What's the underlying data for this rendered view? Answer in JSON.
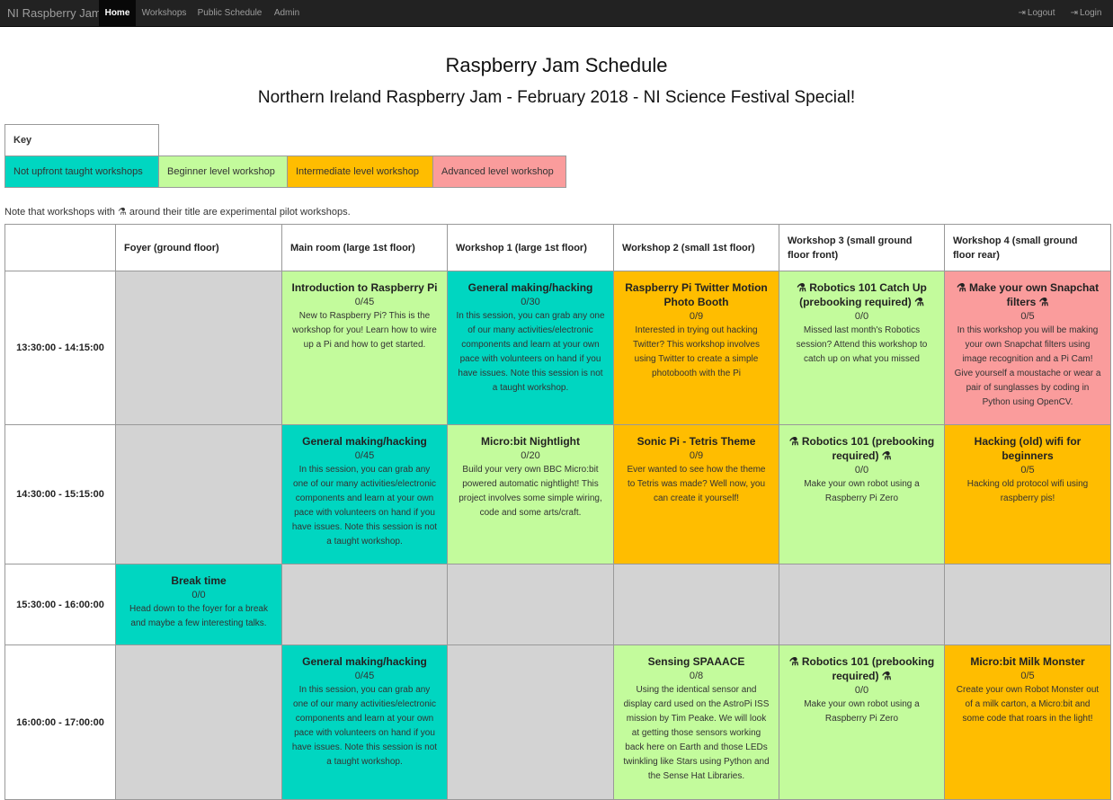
{
  "nav": {
    "brand": "NI Raspberry Jam",
    "items": [
      "Home",
      "Workshops",
      "Public Schedule",
      "Admin"
    ],
    "logout": "Logout",
    "login": "Login"
  },
  "page": {
    "title": "Raspberry Jam Schedule",
    "subtitle": "Northern Ireland Raspberry Jam - February 2018 - NI Science Festival Special!"
  },
  "key": {
    "title": "Key",
    "items": [
      "Not upfront taught workshops",
      "Beginner level workshop",
      "Intermediate level workshop",
      "Advanced level workshop"
    ],
    "colors": [
      "#00d6c1",
      "#c3fb9c",
      "#ffbd00",
      "#fa9c9c"
    ]
  },
  "note": {
    "before": "Note that workshops with",
    "after": "around their title are experimental pilot workshops."
  },
  "schedule": {
    "columns": [
      "Foyer (ground floor)",
      "Main room (large 1st floor)",
      "Workshop 1 (large 1st floor)",
      "Workshop 2 (small 1st floor)",
      "Workshop 3 (small ground floor front)",
      "Workshop 4 (small ground floor rear)"
    ],
    "rows": [
      {
        "time": "13:30:00 - 14:15:00",
        "cells": [
          null,
          {
            "title": "Introduction to Raspberry Pi",
            "count": "0/45",
            "desc": "New to Raspberry Pi? This is the workshop for you! Learn how to wire up a Pi and how to get started.",
            "level": "beginner",
            "pilot": false
          },
          {
            "title": "General making/hacking",
            "count": "0/30",
            "desc": "In this session, you can grab any one of our many activities/electronic components and learn at your own pace with volunteers on hand if you have issues. Note this session is not a taught workshop.",
            "level": "untaught",
            "pilot": false
          },
          {
            "title": "Raspberry Pi Twitter Motion Photo Booth",
            "count": "0/9",
            "desc": "Interested in trying out hacking Twitter? This workshop involves using Twitter to create a simple photobooth with the Pi",
            "level": "intermediate",
            "pilot": false
          },
          {
            "title": "Robotics 101 Catch Up (prebooking required)",
            "count": "0/0",
            "desc": "Missed last month's Robotics session? Attend this workshop to catch up on what you missed",
            "level": "beginner",
            "pilot": true
          },
          {
            "title": "Make your own Snapchat filters",
            "count": "0/5",
            "desc": "In this workshop you will be making your own Snapchat filters using image recognition and a Pi Cam! Give yourself a moustache or wear a pair of sunglasses by coding in Python using OpenCV.",
            "level": "advanced",
            "pilot": true
          }
        ]
      },
      {
        "time": "14:30:00 - 15:15:00",
        "cells": [
          null,
          {
            "title": "General making/hacking",
            "count": "0/45",
            "desc": "In this session, you can grab any one of our many activities/electronic components and learn at your own pace with volunteers on hand if you have issues. Note this session is not a taught workshop.",
            "level": "untaught",
            "pilot": false
          },
          {
            "title": "Micro:bit Nightlight",
            "count": "0/20",
            "desc": "Build your very own BBC Micro:bit powered automatic nightlight! This project involves some simple wiring, code and some arts/craft.",
            "level": "beginner",
            "pilot": false
          },
          {
            "title": "Sonic Pi - Tetris Theme",
            "count": "0/9",
            "desc": "Ever wanted to see how the theme to Tetris was made? Well now, you can create it yourself!",
            "level": "intermediate",
            "pilot": false
          },
          {
            "title": "Robotics 101 (prebooking required)",
            "count": "0/0",
            "desc": "Make your own robot using a Raspberry Pi Zero",
            "level": "beginner",
            "pilot": true
          },
          {
            "title": "Hacking (old) wifi for beginners",
            "count": "0/5",
            "desc": "Hacking old protocol wifi using raspberry pis!",
            "level": "intermediate",
            "pilot": false
          }
        ]
      },
      {
        "time": "15:30:00 - 16:00:00",
        "cells": [
          {
            "title": "Break time",
            "count": "0/0",
            "desc": "Head down to the foyer for a break and maybe a few interesting talks.",
            "level": "untaught",
            "pilot": false
          },
          null,
          null,
          null,
          null,
          null
        ]
      },
      {
        "time": "16:00:00 - 17:00:00",
        "cells": [
          null,
          {
            "title": "General making/hacking",
            "count": "0/45",
            "desc": "In this session, you can grab any one of our many activities/electronic components and learn at your own pace with volunteers on hand if you have issues. Note this session is not a taught workshop.",
            "level": "untaught",
            "pilot": false
          },
          null,
          {
            "title": "Sensing SPAAACE",
            "count": "0/8",
            "desc": "Using the identical sensor and display card used on the AstroPi ISS mission by Tim Peake. We will look at getting those sensors working back here on Earth and those LEDs twinkling like Stars using Python and the Sense Hat Libraries.",
            "level": "beginner",
            "pilot": false
          },
          {
            "title": "Robotics 101 (prebooking required)",
            "count": "0/0",
            "desc": "Make your own robot using a Raspberry Pi Zero",
            "level": "beginner",
            "pilot": true
          },
          {
            "title": "Micro:bit Milk Monster",
            "count": "0/5",
            "desc": "Create your own Robot Monster out of a milk carton, a Micro:bit and some code that roars in the light!",
            "level": "intermediate",
            "pilot": false
          }
        ]
      }
    ]
  }
}
